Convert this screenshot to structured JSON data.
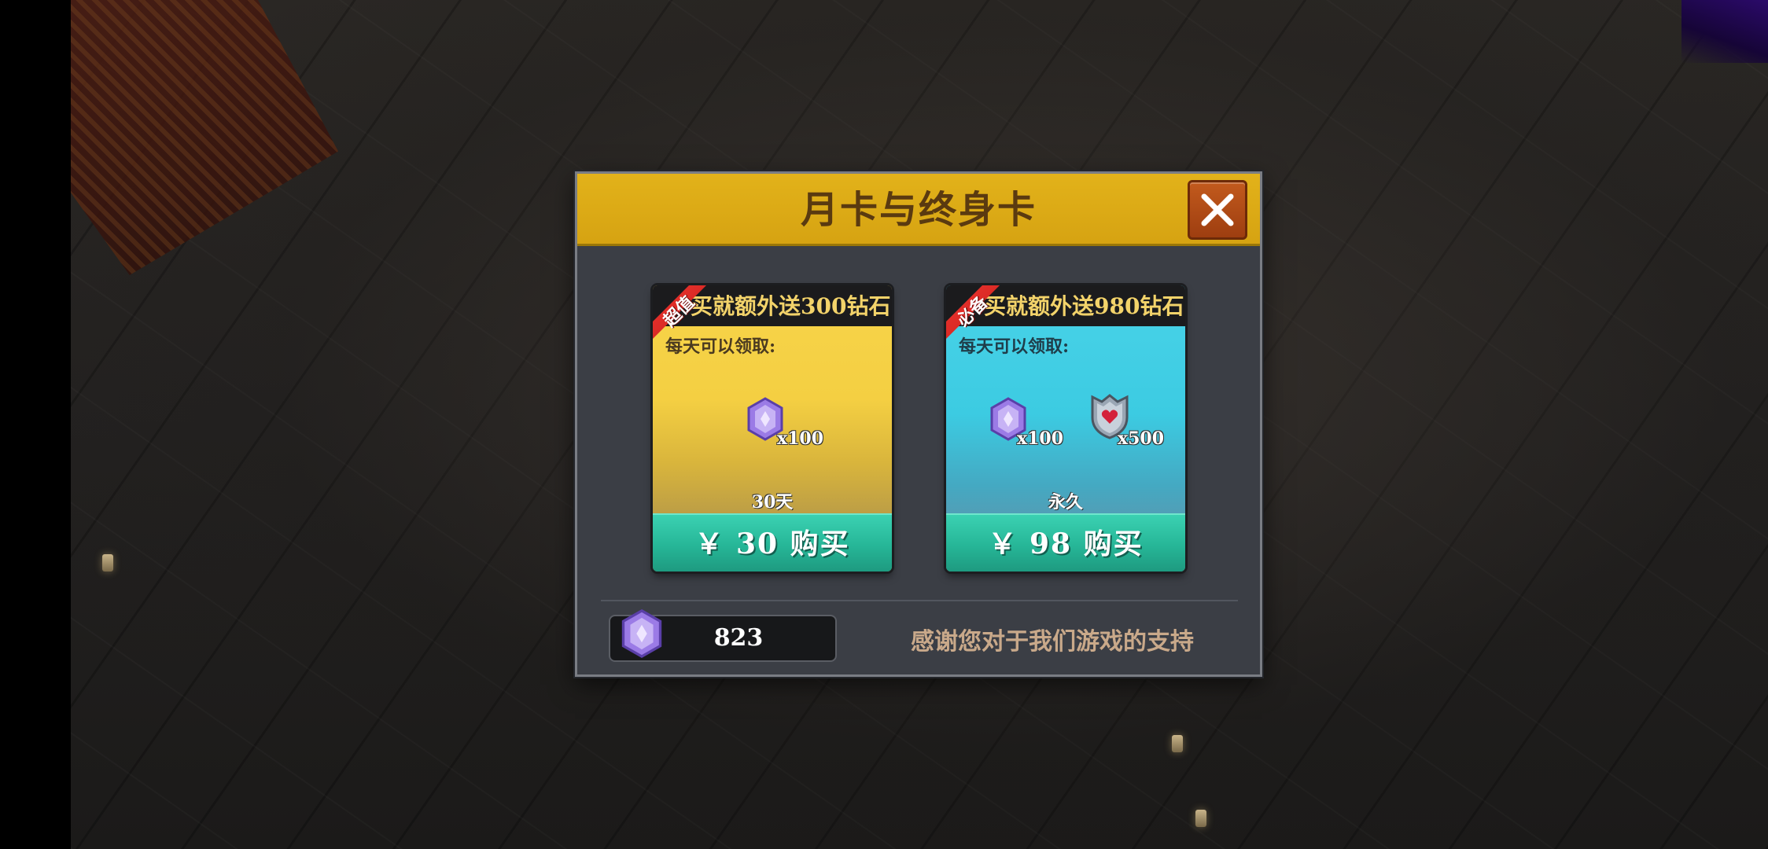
{
  "dialog": {
    "title": "月卡与终身卡",
    "close_icon": "close-x-icon"
  },
  "cards": [
    {
      "ribbon": "超值",
      "headline": "买就额外送300钻石",
      "daily_label": "每天可以领取:",
      "rewards": [
        {
          "icon": "purple-diamond-icon",
          "qty": "x100"
        }
      ],
      "duration": "30天",
      "buy_label": "￥ 30 购买",
      "color": "#f4cf42"
    },
    {
      "ribbon": "必备",
      "headline": "买就额外送980钻石",
      "daily_label": "每天可以领取:",
      "rewards": [
        {
          "icon": "purple-diamond-icon",
          "qty": "x100"
        },
        {
          "icon": "heart-shield-icon",
          "qty": "x500"
        }
      ],
      "duration": "永久",
      "buy_label": "￥ 98 购买",
      "color": "#3ccbe2"
    }
  ],
  "footer": {
    "balance_icon": "purple-diamond-icon",
    "balance": "823",
    "thanks": "感谢您对于我们游戏的支持"
  },
  "colors": {
    "header": "#d6a312",
    "close": "#b04c16",
    "buy": "#26b697",
    "panel": "#3b3e45"
  }
}
